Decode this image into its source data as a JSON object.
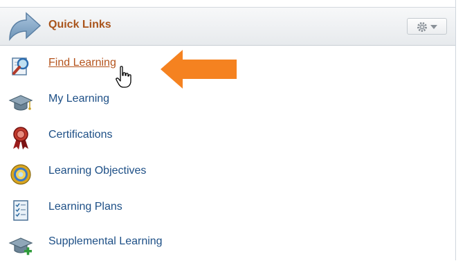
{
  "header": {
    "title": "Quick Links",
    "title_color": "#a9541b",
    "options_icon": "gear-icon",
    "dropdown_icon": "chevron-down-icon"
  },
  "links": [
    {
      "label": "Find Learning",
      "icon": "search-document-icon",
      "hovered": true
    },
    {
      "label": "My Learning",
      "icon": "graduation-cap-icon"
    },
    {
      "label": "Certifications",
      "icon": "ribbon-award-icon"
    },
    {
      "label": "Learning Objectives",
      "icon": "target-icon"
    },
    {
      "label": "Learning Plans",
      "icon": "checklist-icon"
    },
    {
      "label": "Supplemental Learning",
      "icon": "graduation-cap-add-icon"
    }
  ],
  "colors": {
    "link_text": "#1d4f86",
    "link_hover": "#b4531c",
    "annotation_arrow": "#f58220"
  }
}
